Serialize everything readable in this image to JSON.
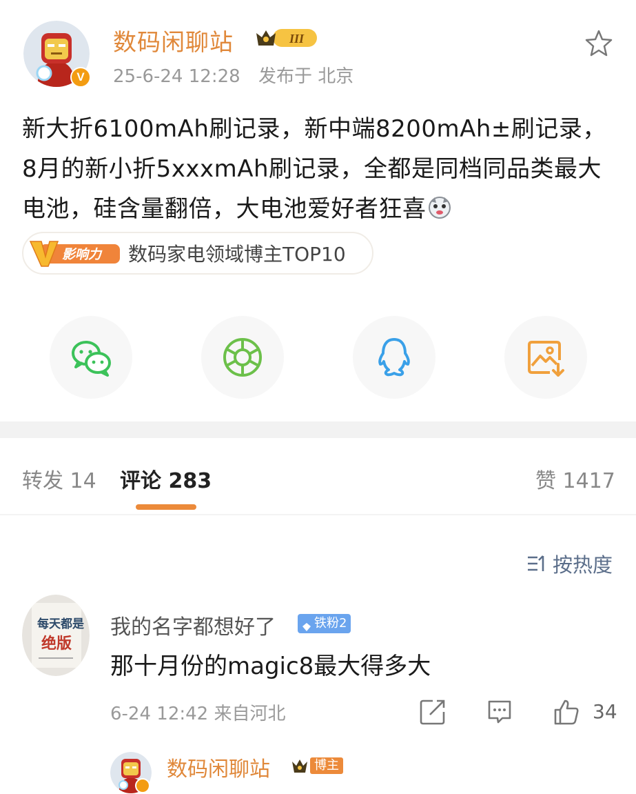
{
  "post": {
    "author": "数码闲聊站",
    "level_badge": "III",
    "verified_mark": "V",
    "timestamp": "25-6-24 12:28",
    "location": "发布于 北京",
    "content": "新大折6100mAh刷记录，新中端8200mAh±刷记录，8月的新小折5xxxmAh刷记录，全都是同档同品类最大电池，硅含量翻倍，大电池爱好者狂喜",
    "influence_logo": "V影响力",
    "influence_text": "数码家电领域博主TOP10"
  },
  "share_icons": [
    "wechat-icon",
    "moments-icon",
    "qq-icon",
    "save-image-icon"
  ],
  "tabs": [
    {
      "label": "转发 14",
      "active": false
    },
    {
      "label": "评论 283",
      "active": true
    },
    {
      "label": "赞 1417",
      "active": false
    }
  ],
  "sort_label": "按热度",
  "comment": {
    "avatar_text": "每天都是绝版",
    "username": "我的名字都想好了",
    "fan_badge": "铁粉2",
    "text": "那十月份的magic8最大得多大",
    "time_location": "6-24 12:42 来自河北",
    "likes": "34"
  },
  "reply": {
    "username": "数码闲聊站",
    "badge": "博主"
  },
  "colors": {
    "brand_orange": "#e0883a",
    "accent_orange": "#ec8a3a",
    "wechat_green": "#3cc25a",
    "moments_green": "#6cc04a",
    "qq_blue": "#3aa0e8",
    "save_orange": "#f0a03c",
    "fan_blue": "#6aa4ee"
  }
}
